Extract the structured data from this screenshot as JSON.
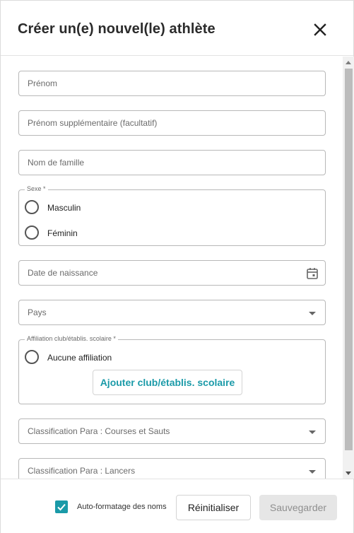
{
  "dialog": {
    "title": "Créer un(e) nouvel(le) athlète",
    "close_icon": "close-icon"
  },
  "form": {
    "first_name": {
      "placeholder": "Prénom"
    },
    "middle_name": {
      "placeholder": "Prénom supplémentaire (facultatif)"
    },
    "last_name": {
      "placeholder": "Nom de famille"
    },
    "sex": {
      "legend": "Sexe *",
      "options": [
        "Masculin",
        "Féminin"
      ]
    },
    "birth_date": {
      "placeholder": "Date de naissance",
      "icon": "calendar-icon"
    },
    "country": {
      "placeholder": "Pays",
      "icon": "dropdown-arrow-icon"
    },
    "affiliation": {
      "legend": "Affiliation club/établis. scolaire *",
      "option": "Aucune affiliation",
      "add_button": "Ajouter club/établis. scolaire"
    },
    "para_running": {
      "placeholder": "Classification Para : Courses et Sauts",
      "icon": "dropdown-arrow-icon"
    },
    "para_throws": {
      "placeholder": "Classification Para : Lancers",
      "icon": "dropdown-arrow-icon"
    }
  },
  "footer": {
    "auto_format_label": "Auto-formatage des noms",
    "auto_format_checked": true,
    "reset_label": "Réinitialiser",
    "save_label": "Sauvegarder"
  },
  "colors": {
    "accent": "#1a9aa8",
    "disabled_bg": "#e6e6e6",
    "border": "#b8b8b8"
  }
}
